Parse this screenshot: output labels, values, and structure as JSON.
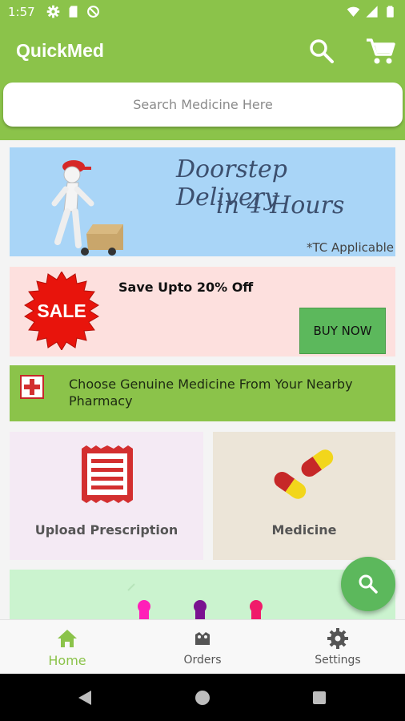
{
  "status_bar": {
    "time": "1:57",
    "icons": [
      "gear-icon",
      "sd-card-icon",
      "no-disturb-icon",
      "wifi-icon",
      "signal-icon",
      "battery-icon"
    ]
  },
  "app_bar": {
    "title": "QuickMed",
    "icons": [
      "search-icon",
      "cart-icon"
    ],
    "color": "#8bc34a"
  },
  "search": {
    "placeholder": "Search Medicine Here"
  },
  "banners": {
    "delivery": {
      "line1": "Doorstep Delivery",
      "line2": "in 4 Hours",
      "note": "*TC Applicable"
    },
    "sale": {
      "badge": "SALE",
      "text": "Save Upto 20% Off",
      "button": "BUY NOW"
    },
    "genuine": {
      "text": "Choose Genuine Medicine From Your Nearby Pharmacy"
    }
  },
  "cards": {
    "upload_label": "Upload Prescription",
    "medicine_label": "Medicine"
  },
  "bottom_nav": {
    "items": [
      {
        "label": "Home",
        "icon": "home-icon",
        "active": true
      },
      {
        "label": "Orders",
        "icon": "orders-icon",
        "active": false
      },
      {
        "label": "Settings",
        "icon": "settings-icon",
        "active": false
      }
    ],
    "active_color": "#8bc34a"
  },
  "system_nav": {
    "icons": [
      "back-icon",
      "home-circle-icon",
      "recents-icon"
    ]
  }
}
